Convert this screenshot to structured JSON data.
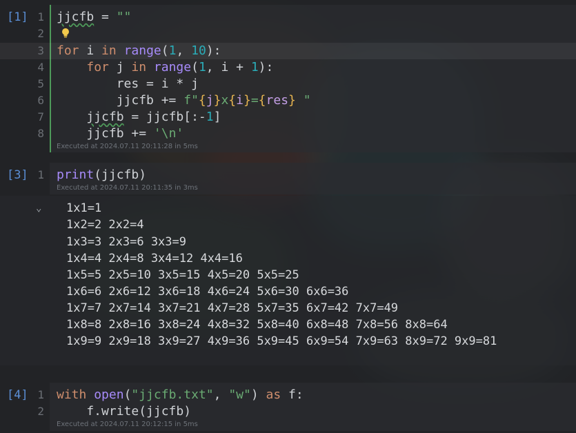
{
  "cells": [
    {
      "prompt": "[1]",
      "lines": [
        {
          "num": "1",
          "tokens": [
            [
              "sq",
              "jjcfb"
            ],
            [
              "plain",
              " = "
            ],
            [
              "str",
              "\"\""
            ]
          ]
        },
        {
          "num": "2",
          "tokens": []
        },
        {
          "num": "3",
          "tokens": [
            [
              "kw2",
              "for"
            ],
            [
              "plain",
              " i "
            ],
            [
              "kw2",
              "in"
            ],
            [
              "plain",
              " "
            ],
            [
              "fn",
              "range"
            ],
            [
              "plain",
              "("
            ],
            [
              "num",
              "1"
            ],
            [
              "plain",
              ", "
            ],
            [
              "num",
              "10"
            ],
            [
              "plain",
              "):"
            ]
          ]
        },
        {
          "num": "4",
          "tokens": [
            [
              "plain",
              "    "
            ],
            [
              "kw2",
              "for"
            ],
            [
              "plain",
              " j "
            ],
            [
              "kw2",
              "in"
            ],
            [
              "plain",
              " "
            ],
            [
              "fn",
              "range"
            ],
            [
              "plain",
              "("
            ],
            [
              "num",
              "1"
            ],
            [
              "plain",
              ", i + "
            ],
            [
              "num",
              "1"
            ],
            [
              "plain",
              "):"
            ]
          ]
        },
        {
          "num": "5",
          "tokens": [
            [
              "plain",
              "        res = i * j"
            ]
          ]
        },
        {
          "num": "6",
          "tokens": [
            [
              "plain",
              "        jjcfb += "
            ],
            [
              "str",
              "f\""
            ],
            [
              "brace",
              "{"
            ],
            [
              "fvar",
              "j"
            ],
            [
              "brace",
              "}"
            ],
            [
              "str",
              "x"
            ],
            [
              "brace",
              "{"
            ],
            [
              "fvar",
              "i"
            ],
            [
              "brace",
              "}"
            ],
            [
              "str",
              "="
            ],
            [
              "brace",
              "{"
            ],
            [
              "fvar",
              "res"
            ],
            [
              "brace",
              "}"
            ],
            [
              "str",
              " \""
            ]
          ]
        },
        {
          "num": "7",
          "tokens": [
            [
              "plain",
              "    "
            ],
            [
              "sq",
              "jjcfb"
            ],
            [
              "plain",
              " = jjcfb[:-"
            ],
            [
              "num",
              "1"
            ],
            [
              "plain",
              "]"
            ]
          ]
        },
        {
          "num": "8",
          "tokens": [
            [
              "plain",
              "    jjcfb += "
            ],
            [
              "str",
              "'\\n'"
            ]
          ]
        }
      ],
      "executed": "Executed at 2024.07.11 20:11:28 in 5ms"
    },
    {
      "prompt": "[3]",
      "lines": [
        {
          "num": "1",
          "tokens": [
            [
              "fn",
              "print"
            ],
            [
              "plain",
              "(jjcfb)"
            ]
          ]
        }
      ],
      "executed": "Executed at 2024.07.11 20:11:35 in 3ms"
    },
    {
      "prompt": "[4]",
      "lines": [
        {
          "num": "1",
          "tokens": [
            [
              "kw2",
              "with"
            ],
            [
              "plain",
              " "
            ],
            [
              "fn",
              "open"
            ],
            [
              "plain",
              "("
            ],
            [
              "str",
              "\"jjcfb.txt\""
            ],
            [
              "plain",
              ", "
            ],
            [
              "str",
              "\"w\""
            ],
            [
              "plain",
              ") "
            ],
            [
              "kw2",
              "as"
            ],
            [
              "plain",
              " f:"
            ]
          ]
        },
        {
          "num": "2",
          "tokens": [
            [
              "plain",
              "    f.write(jjcfb)"
            ]
          ]
        }
      ],
      "executed": "Executed at 2024.07.11 20:12:15 in 5ms"
    }
  ],
  "output": {
    "collapse_icon": "chevron-down-icon",
    "lines": [
      "1x1=1",
      "1x2=2 2x2=4",
      "1x3=3 2x3=6 3x3=9",
      "1x4=4 2x4=8 3x4=12 4x4=16",
      "1x5=5 2x5=10 3x5=15 4x5=20 5x5=25",
      "1x6=6 2x6=12 3x6=18 4x6=24 5x6=30 6x6=36",
      "1x7=7 2x7=14 3x7=21 4x7=28 5x7=35 6x7=42 7x7=49",
      "1x8=8 2x8=16 3x8=24 4x8=32 5x8=40 6x8=48 7x8=56 8x8=64",
      "1x9=9 2x9=18 3x9=27 4x9=36 5x9=45 6x9=54 7x9=63 8x9=72 9x9=81"
    ]
  },
  "colors": {
    "accent_green": "#4e9a5a",
    "prompt_blue": "#5b8fd6",
    "bulb": "#f2c94c"
  }
}
